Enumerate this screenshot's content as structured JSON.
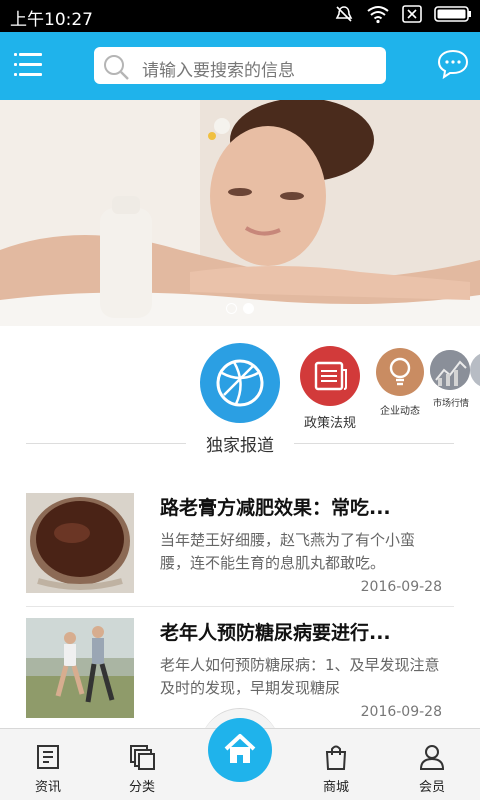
{
  "status_bar": {
    "time": "上午10:27"
  },
  "header": {
    "search_placeholder": "请输入要搜索的信息"
  },
  "banner": {
    "slide_count": 2,
    "active_slide": 2
  },
  "categories": [
    {
      "label": "独家报道",
      "color": "#2b9fe3",
      "icon": "basketball-icon"
    },
    {
      "label": "政策法规",
      "color": "#d23a3a",
      "icon": "newspaper-icon"
    },
    {
      "label": "企业动态",
      "color": "#c98c62",
      "icon": "lightbulb-icon"
    },
    {
      "label": "市场行情",
      "color": "#8a8f99",
      "icon": "chart-photo-icon"
    }
  ],
  "news": [
    {
      "title": "路老膏方减肥效果：常吃...",
      "summary": "当年楚王好细腰，赵飞燕为了有个小蛮腰，连不能生育的息肌丸都敢吃。",
      "date": "2016-09-28"
    },
    {
      "title": "老年人预防糖尿病要进行...",
      "summary": "老年人如何预防糖尿病：1、及早发现注意及时的发现，早期发现糖尿",
      "date": "2016-09-28"
    }
  ],
  "bottom_nav": {
    "items": [
      {
        "label": "资讯",
        "icon": "news-icon"
      },
      {
        "label": "分类",
        "icon": "category-icon"
      },
      {
        "label": "",
        "icon": "home-icon"
      },
      {
        "label": "商城",
        "icon": "shopping-bag-icon"
      },
      {
        "label": "会员",
        "icon": "user-icon"
      }
    ]
  },
  "colors": {
    "accent": "#1fb3eb",
    "nav_bg": "#f4f4f4"
  }
}
